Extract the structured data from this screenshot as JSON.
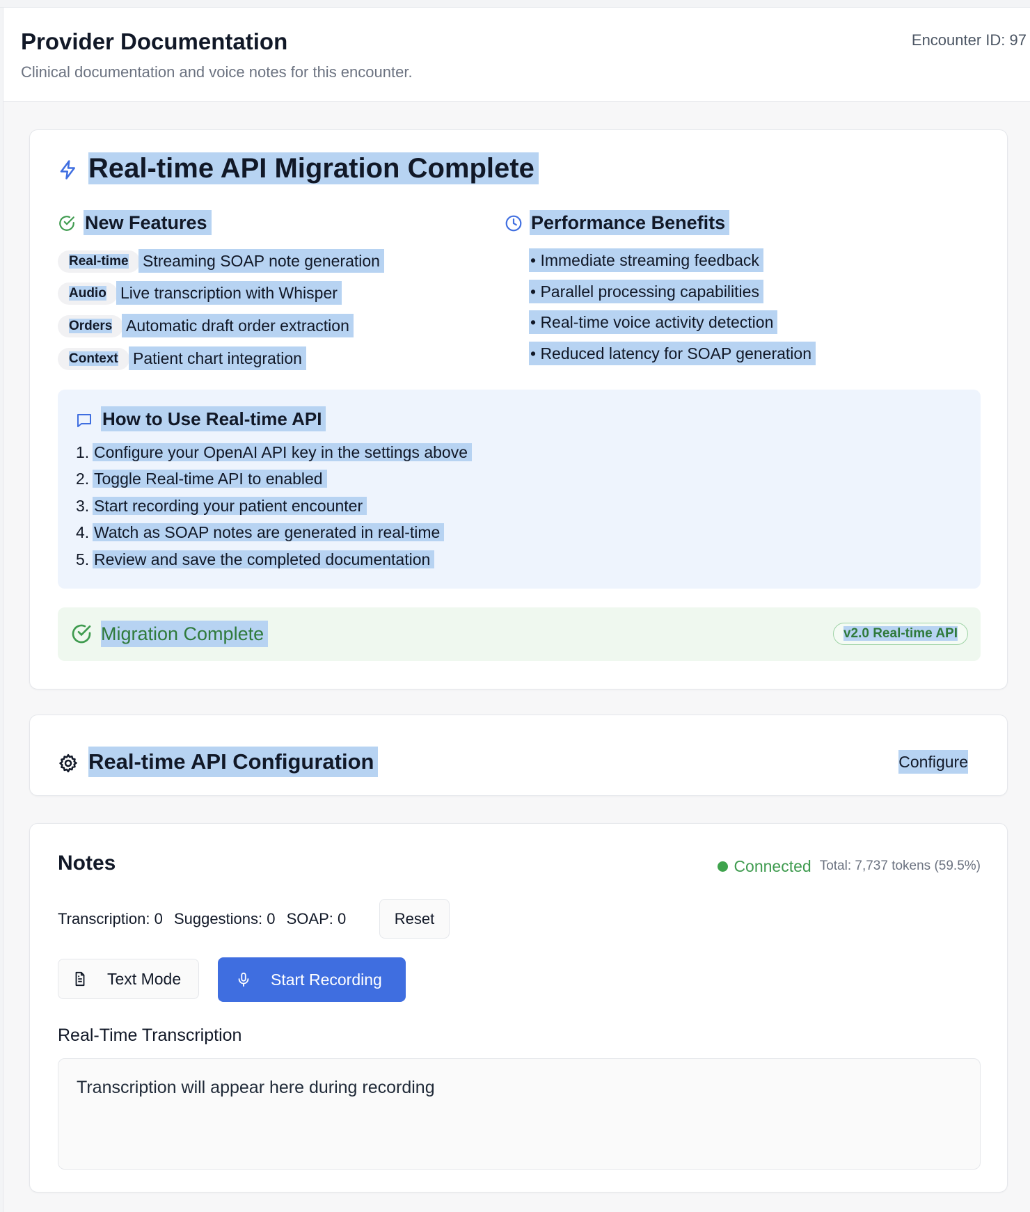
{
  "header": {
    "title": "Provider Documentation",
    "subtitle": "Clinical documentation and voice notes for this encounter.",
    "encounter_id": "Encounter ID: 97"
  },
  "migration": {
    "title": "Real-time API Migration Complete",
    "new_features": {
      "heading": "New Features",
      "items": [
        {
          "tag": "Real-time",
          "text": "Streaming SOAP note generation"
        },
        {
          "tag": "Audio",
          "text": "Live transcription with Whisper"
        },
        {
          "tag": "Orders",
          "text": "Automatic draft order extraction"
        },
        {
          "tag": "Context",
          "text": "Patient chart integration"
        }
      ]
    },
    "performance": {
      "heading": "Performance Benefits",
      "items": [
        "• Immediate streaming feedback",
        "• Parallel processing capabilities",
        "• Real-time voice activity detection",
        "• Reduced latency for SOAP generation"
      ]
    },
    "how_to": {
      "heading": "How to Use Real-time API",
      "steps": [
        {
          "num": "1.",
          "text": "Configure your OpenAI API key in the settings above"
        },
        {
          "num": "2.",
          "text": "Toggle Real-time API to enabled"
        },
        {
          "num": "3.",
          "text": "Start recording your patient encounter"
        },
        {
          "num": "4.",
          "text": "Watch as SOAP notes are generated in real-time"
        },
        {
          "num": "5.",
          "text": "Review and save the completed documentation"
        }
      ]
    },
    "status": {
      "label": "Migration Complete",
      "version": "v2.0 Real-time API"
    }
  },
  "config": {
    "title": "Real-time API Configuration",
    "button": "Configure"
  },
  "notes": {
    "title": "Notes",
    "status": "Connected",
    "tokens": "Total: 7,737 tokens (59.5%)",
    "counters": {
      "transcription": "Transcription: 0",
      "suggestions": "Suggestions: 0",
      "soap": "SOAP: 0"
    },
    "reset_label": "Reset",
    "text_mode_label": "Text Mode",
    "record_label": "Start Recording",
    "transcription_heading": "Real-Time Transcription",
    "transcription_placeholder": "Transcription will appear here during recording"
  },
  "colors": {
    "accent": "#3f6ee0",
    "success": "#3f9b4f",
    "selection": "#b7d3f2"
  },
  "icons": {
    "migration": "lightning-icon",
    "features": "check-circle-icon",
    "performance": "clock-icon",
    "how_to": "message-square-icon",
    "done": "check-circle-icon",
    "config": "gear-icon",
    "text_mode": "file-text-icon",
    "record": "microphone-icon"
  }
}
